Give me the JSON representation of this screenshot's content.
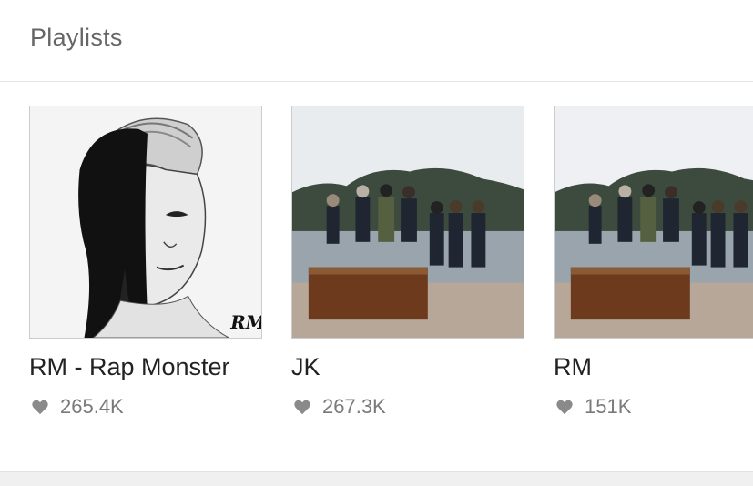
{
  "section": {
    "title": "Playlists"
  },
  "playlists": [
    {
      "name": "RM - Rap Monster",
      "likes": "265.4K",
      "cover_art": "RM"
    },
    {
      "name": "JK",
      "likes": "267.3K"
    },
    {
      "name": "RM",
      "likes": "151K"
    }
  ],
  "icons": {
    "like": "heart-icon"
  },
  "colors": {
    "like_icon": "#8a8a8a",
    "text_muted": "#7a7a7a"
  }
}
